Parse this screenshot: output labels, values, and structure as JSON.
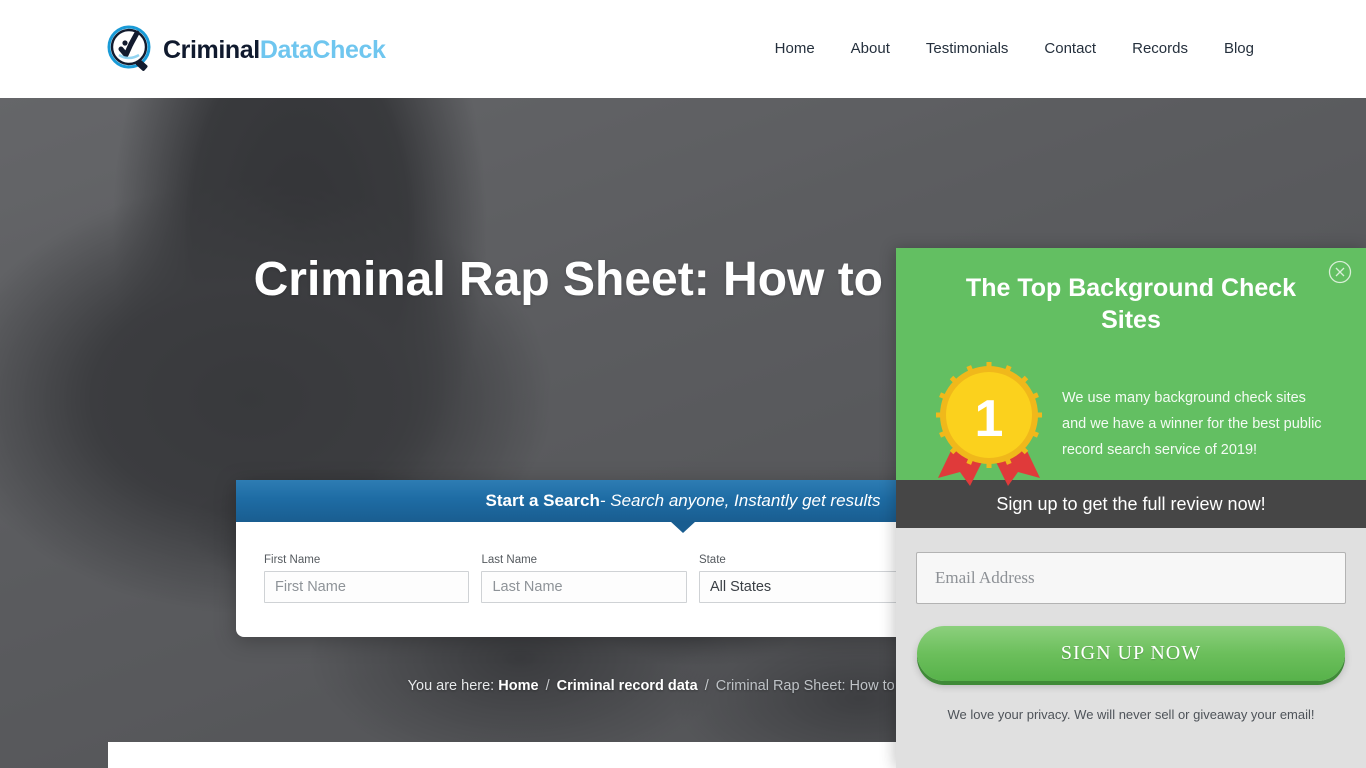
{
  "header": {
    "logo": {
      "icon": "magnifier-check-icon",
      "text_primary": "Criminal",
      "text_secondary": "DataCheck"
    },
    "nav": [
      {
        "label": "Home"
      },
      {
        "label": "About"
      },
      {
        "label": "Testimonials"
      },
      {
        "label": "Contact"
      },
      {
        "label": "Records"
      },
      {
        "label": "Blog"
      }
    ]
  },
  "hero": {
    "title": "Criminal Rap Sheet: How to get yours",
    "background_image": "grayscale-hand-gesture-photo"
  },
  "search_panel": {
    "bar_strong": "Start a Search",
    "bar_em": " - Search anyone, Instantly get results",
    "fields": {
      "first_name": {
        "label": "First Name",
        "placeholder": "First Name",
        "value": ""
      },
      "last_name": {
        "label": "Last Name",
        "placeholder": "Last Name",
        "value": ""
      },
      "state": {
        "label": "State",
        "selected": "All States",
        "options": [
          "All States"
        ]
      }
    }
  },
  "breadcrumb": {
    "prefix": "You are here:",
    "home": "Home",
    "sep": "/",
    "category": "Criminal record data",
    "current": "Criminal Rap Sheet: How to get yours"
  },
  "popup": {
    "title": "The Top Background Check Sites",
    "close_icon": "close-circle-icon",
    "badge": {
      "icon": "award-ribbon-icon",
      "number": "1",
      "gold": "#f6c91e",
      "ribbon_red": "#e03a3a"
    },
    "body": "We use many background check sites and we have a winner for the best public record search service of 2019!",
    "band_text": "Sign up to get the full review now!",
    "email": {
      "placeholder": "Email Address",
      "value": ""
    },
    "submit_label": "SIGN UP NOW",
    "privacy": "We love your privacy.  We will never sell or giveaway your email!",
    "accent_green": "#63bf62",
    "band_gray": "#464646"
  }
}
